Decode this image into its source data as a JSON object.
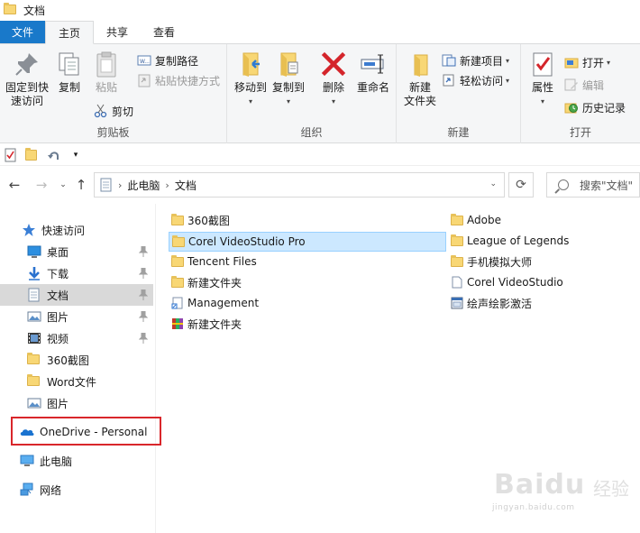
{
  "window": {
    "title": "文档"
  },
  "ribbon_tabs": [
    {
      "label": "文件"
    },
    {
      "label": "主页"
    },
    {
      "label": "共享"
    },
    {
      "label": "查看"
    }
  ],
  "ribbon": {
    "clipboard": {
      "label": "剪贴板",
      "pin_quick": "固定到快\n速访问",
      "copy": "复制",
      "paste": "粘贴",
      "copy_path": "复制路径",
      "paste_shortcut": "粘贴快捷方式",
      "cut": "剪切"
    },
    "organize": {
      "label": "组织",
      "move_to": "移动到",
      "copy_to": "复制到",
      "delete": "删除",
      "rename": "重命名"
    },
    "new": {
      "label": "新建",
      "new_folder": "新建\n文件夹",
      "new_item": "新建项目",
      "easy_access": "轻松访问"
    },
    "open": {
      "label": "打开",
      "properties": "属性",
      "open": "打开",
      "edit": "编辑",
      "history": "历史记录"
    }
  },
  "address": {
    "crumbs": [
      "此电脑",
      "文档"
    ],
    "search_placeholder": "搜索\"文档\""
  },
  "nav_pane": {
    "quick_access": "快速访问",
    "items": [
      {
        "label": "桌面"
      },
      {
        "label": "下载"
      },
      {
        "label": "文档"
      },
      {
        "label": "图片"
      },
      {
        "label": "视频"
      },
      {
        "label": "360截图"
      },
      {
        "label": "Word文件"
      },
      {
        "label": "图片"
      }
    ],
    "onedrive": "OneDrive - Personal",
    "this_pc": "此电脑",
    "network": "网络"
  },
  "files": {
    "left": [
      {
        "name": "360截图"
      },
      {
        "name": "Corel VideoStudio Pro"
      },
      {
        "name": "Tencent Files"
      },
      {
        "name": "新建文件夹"
      },
      {
        "name": "Management"
      },
      {
        "name": "新建文件夹"
      }
    ],
    "right": [
      {
        "name": "Adobe"
      },
      {
        "name": "League of Legends"
      },
      {
        "name": "手机模拟大师"
      },
      {
        "name": "Corel VideoStudio"
      },
      {
        "name": "绘声绘影激活"
      }
    ]
  },
  "watermark": {
    "brand": "Baidu",
    "zh": "经验",
    "url": "jingyan.baidu.com"
  },
  "colors": {
    "file_tab": "#1979ca",
    "highlight_row": "#cce8ff",
    "selected_nav": "#d9d9d9",
    "annotation_box": "#d9262b"
  }
}
